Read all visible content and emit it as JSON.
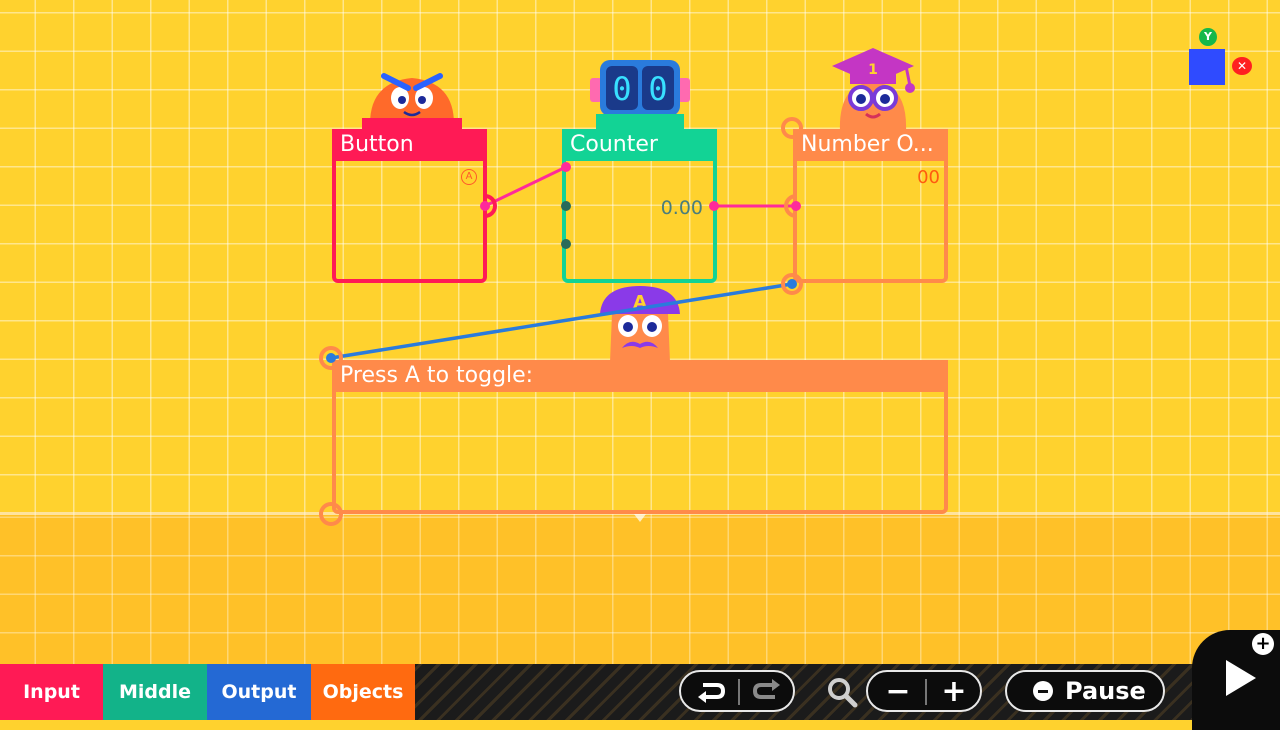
{
  "nodes": {
    "button": {
      "title": "Button",
      "input_glyph": "A"
    },
    "counter": {
      "title": "Counter",
      "value": "0.00"
    },
    "number_output": {
      "title": "Number O...",
      "value": "00"
    },
    "text_object": {
      "title": "Press A to toggle:"
    }
  },
  "minimap": {
    "y_label": "Y",
    "x_label": "✕"
  },
  "toolbar": {
    "tabs": [
      "Input",
      "Middle",
      "Output",
      "Objects"
    ],
    "undo_icon": "undo-icon",
    "redo_icon": "redo-icon",
    "zoom_out_label": "−",
    "zoom_in_label": "+",
    "pause_label": "Pause",
    "play_plus": "+"
  },
  "colors": {
    "background": "#ffd22e",
    "input": "#ff1a55",
    "middle": "#12d395",
    "output": "#2469d4",
    "objects": "#ff8a4a",
    "wire_pink": "#ff2a9a",
    "wire_blue": "#2a7bdc"
  }
}
